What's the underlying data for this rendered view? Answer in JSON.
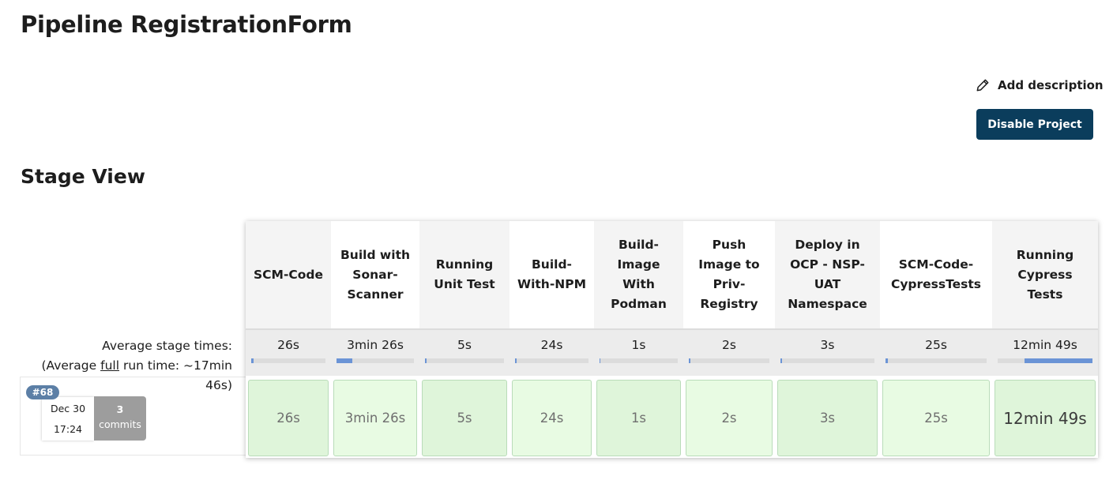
{
  "page": {
    "title": "Pipeline RegistrationForm",
    "add_description": "Add description",
    "disable_button": "Disable Project",
    "stage_view_title": "Stage View"
  },
  "average": {
    "line1": "Average stage times:",
    "line2_prefix": "(Average ",
    "line2_link": "full",
    "line2_suffix": " run time: ~17min 46s)"
  },
  "build": {
    "number": "#68",
    "date": "Dec 30",
    "time": "17:24",
    "commits_count": "3",
    "commits_label": "commits"
  },
  "colors": {
    "button_bg": "#0b3d5c",
    "badge_bg": "#5c7fa6",
    "success_cell": "#e5f9e0",
    "avg_bar_fill": "#6b94d6"
  },
  "stages": [
    {
      "name": "SCM-Code",
      "avg": "26s",
      "cell": "26s",
      "avg_fraction": 0.03
    },
    {
      "name": "Build with Sonar-Scanner",
      "avg": "3min 26s",
      "cell": "3min 26s",
      "avg_fraction": 0.2
    },
    {
      "name": "Running Unit Test",
      "avg": "5s",
      "cell": "5s",
      "avg_fraction": 0.005
    },
    {
      "name": "Build-With-NPM",
      "avg": "24s",
      "cell": "24s",
      "avg_fraction": 0.02
    },
    {
      "name": "Build-Image With Podman",
      "avg": "1s",
      "cell": "1s",
      "avg_fraction": 0.001
    },
    {
      "name": "Push Image to Priv-Registry",
      "avg": "2s",
      "cell": "2s",
      "avg_fraction": 0.002
    },
    {
      "name": "Deploy in OCP - NSP-UAT Namespace",
      "avg": "3s",
      "cell": "3s",
      "avg_fraction": 0.003
    },
    {
      "name": "SCM-Code-CypressTests",
      "avg": "25s",
      "cell": "25s",
      "avg_fraction": 0.02
    },
    {
      "name": "Running Cypress Tests",
      "avg": "12min 49s",
      "cell": "12min 49s",
      "avg_fraction": 0.72
    }
  ]
}
